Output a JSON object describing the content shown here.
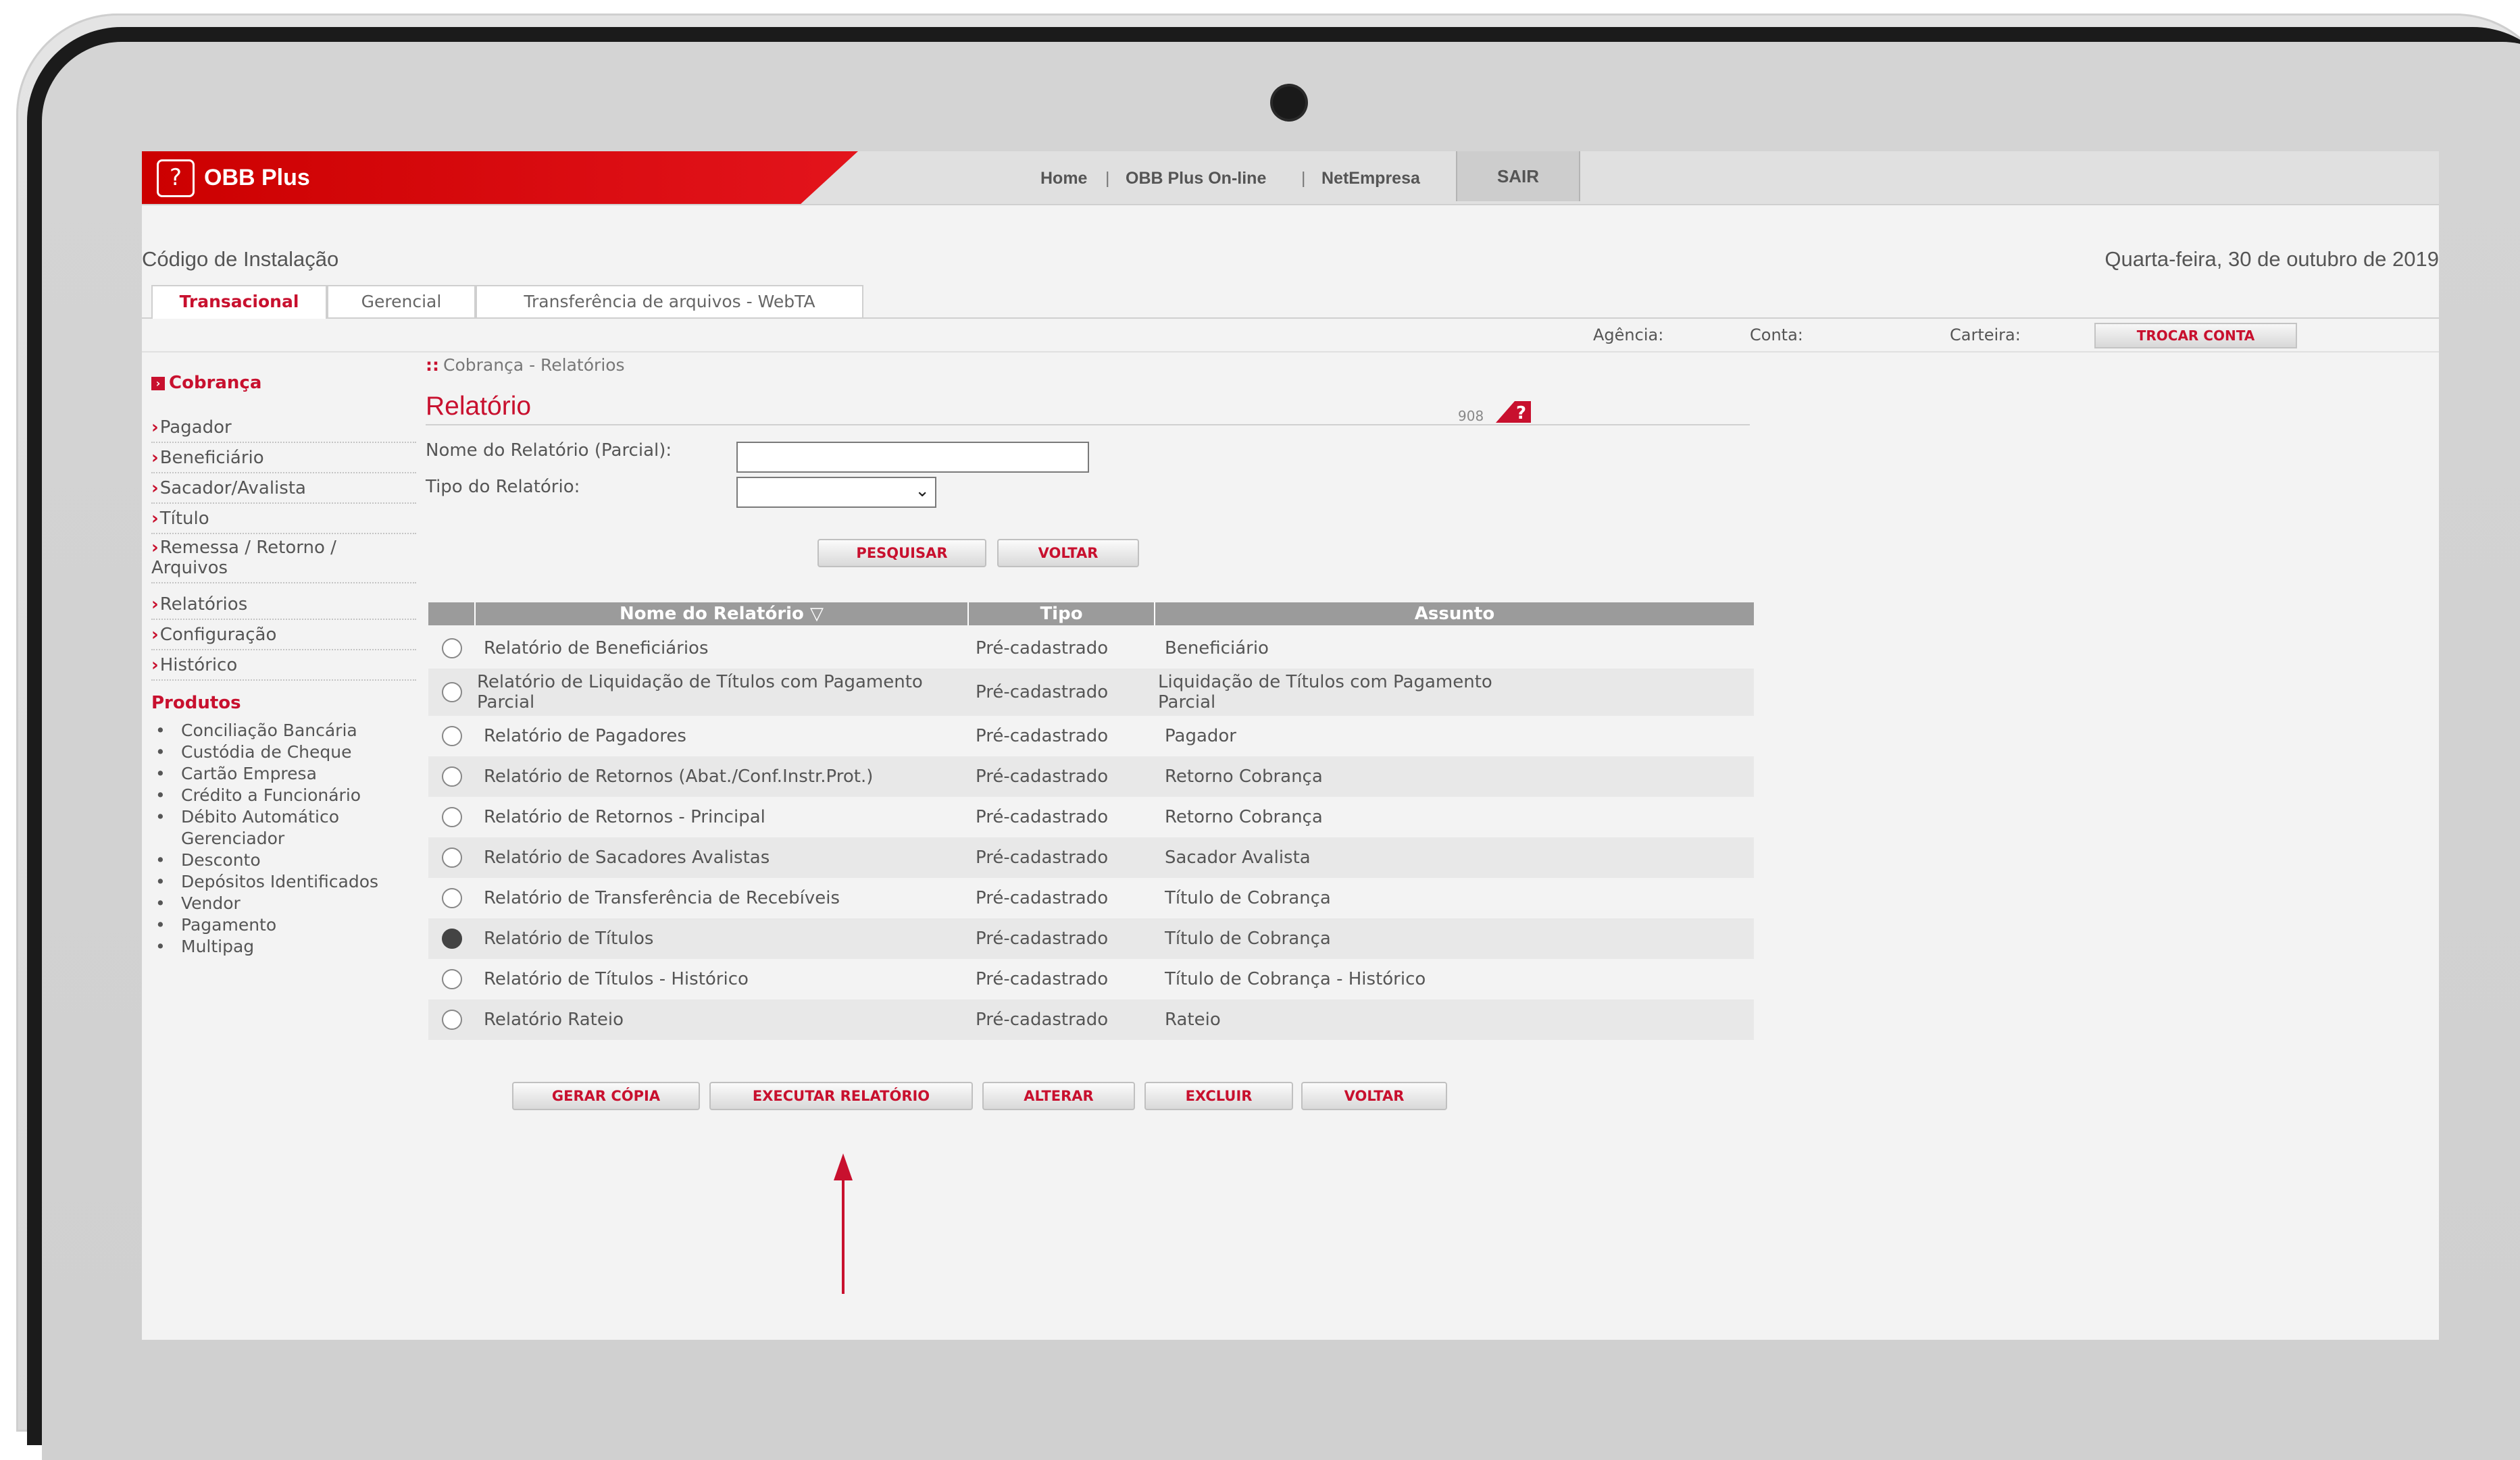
{
  "app": {
    "title": "OBB Plus",
    "logo_glyph": "?"
  },
  "topnav": {
    "home": "Home",
    "online": "OBB Plus On-line",
    "netempresa": "NetEmpresa",
    "sep": "|",
    "sair": "SAIR"
  },
  "install_code_label": "Código de Instalação",
  "date": "Quarta-feira, 30 de outubro de 2019",
  "tabs": [
    "Transacional",
    "Gerencial",
    "Transferência de arquivos - WebTA"
  ],
  "account": {
    "agencia": "Agência:",
    "conta": "Conta:",
    "carteira": "Carteira:",
    "trocar": "TROCAR CONTA"
  },
  "sidebar": {
    "title": "Cobrança",
    "items": [
      "Pagador",
      "Beneficiário",
      "Sacador/Avalista",
      "Título",
      "Remessa / Retorno / Arquivos",
      "Relatórios",
      "Configuração",
      "Histórico"
    ],
    "products_title": "Produtos",
    "products": [
      "Conciliação Bancária",
      "Custódia de Cheque",
      "Cartão Empresa",
      "Crédito a Funcionário",
      "Débito Automático Gerenciador",
      "Desconto",
      "Depósitos Identificados",
      "Vendor",
      "Pagamento",
      "Multipag"
    ]
  },
  "breadcrumb": "Cobrança - Relatórios",
  "page": {
    "title": "Relatório",
    "code": "908"
  },
  "form": {
    "name_label": "Nome do Relatório (Parcial):",
    "type_label": "Tipo do Relatório:",
    "name_value": "",
    "type_value": ""
  },
  "buttons": {
    "pesquisar": "PESQUISAR",
    "voltar": "VOLTAR",
    "gerar": "GERAR CÓPIA",
    "executar": "EXECUTAR RELATÓRIO",
    "alterar": "ALTERAR",
    "excluir": "EXCLUIR",
    "voltar2": "VOLTAR"
  },
  "table": {
    "headers": [
      "Nome do Relatório",
      "Tipo",
      "Assunto"
    ],
    "sort_icon": "▽",
    "rows": [
      {
        "name": "Relatório de Beneficiários",
        "tipo": "Pré-cadastrado",
        "assunto": "Beneficiário",
        "selected": false
      },
      {
        "name": "Relatório de Liquidação de Títulos com Pagamento Parcial",
        "tipo": "Pré-cadastrado",
        "assunto": "Liquidação de Títulos com Pagamento Parcial",
        "selected": false
      },
      {
        "name": "Relatório de Pagadores",
        "tipo": "Pré-cadastrado",
        "assunto": "Pagador",
        "selected": false
      },
      {
        "name": "Relatório de Retornos (Abat./Conf.Instr.Prot.)",
        "tipo": "Pré-cadastrado",
        "assunto": "Retorno Cobrança",
        "selected": false
      },
      {
        "name": "Relatório de Retornos - Principal",
        "tipo": "Pré-cadastrado",
        "assunto": "Retorno Cobrança",
        "selected": false
      },
      {
        "name": "Relatório de Sacadores Avalistas",
        "tipo": "Pré-cadastrado",
        "assunto": "Sacador Avalista",
        "selected": false
      },
      {
        "name": "Relatório de Transferência de Recebíveis",
        "tipo": "Pré-cadastrado",
        "assunto": "Título de Cobrança",
        "selected": false
      },
      {
        "name": "Relatório de Títulos",
        "tipo": "Pré-cadastrado",
        "assunto": "Título de Cobrança",
        "selected": true
      },
      {
        "name": "Relatório de Títulos - Histórico",
        "tipo": "Pré-cadastrado",
        "assunto": "Título de Cobrança - Histórico",
        "selected": false
      },
      {
        "name": "Relatório Rateio",
        "tipo": "Pré-cadastrado",
        "assunto": "Rateio",
        "selected": false
      }
    ]
  },
  "colors": {
    "brand_red": "#c8102e",
    "header_gray": "#9b9b9b"
  },
  "icons": {
    "help": "help-question-icon",
    "sort": "sort-down-icon",
    "annotation": "red-arrow-up-icon"
  }
}
